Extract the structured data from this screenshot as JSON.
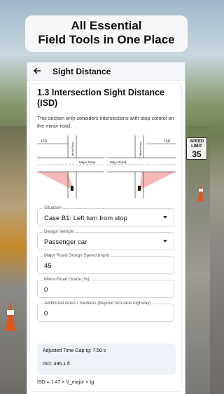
{
  "banner": {
    "line1": "All Essential",
    "line2": "Field Tools in One Place"
  },
  "background_sign": {
    "line1": "SPEED LIMIT",
    "value": "35"
  },
  "appbar": {
    "back_icon": "arrow-left-icon",
    "title": "Sight Distance"
  },
  "section": {
    "title": "1.3 Intersection Sight Distance (ISD)",
    "description": "This section only considers intersections with stop control on the minor road."
  },
  "diagram": {
    "left": {
      "isd_label": "ISD",
      "minor_road": "Minor Road",
      "major_road": "Major Road"
    },
    "right": {
      "isd_label": "ISD",
      "minor_road": "Minor Road",
      "major_road": "Major Road"
    },
    "sight_triangle_color": "#f4b8b8",
    "road_line_color": "#555555"
  },
  "form": {
    "situation": {
      "label": "Situation",
      "value": "Case B1: Left turn from stop"
    },
    "design_vehicle": {
      "label": "Design Vehicle",
      "value": "Passenger car"
    },
    "major_speed": {
      "label": "Major Road Design Speed (mph)",
      "value": "45"
    },
    "minor_grade": {
      "label": "Minor-Road Grade (%)",
      "value": "0"
    },
    "additional_lanes": {
      "label": "Additional lanes / medians (beyond two-lane highway)",
      "value": "0"
    }
  },
  "results": {
    "time_gap": "Adjusted Time Gap tg: 7.50 s",
    "isd": "ISD: 496.1 ft",
    "formula": "ISD = 1.47 × V_major × tg"
  },
  "colors": {
    "result_bg": "#edf2fa",
    "appbar_bg": "#f3f5fb"
  }
}
